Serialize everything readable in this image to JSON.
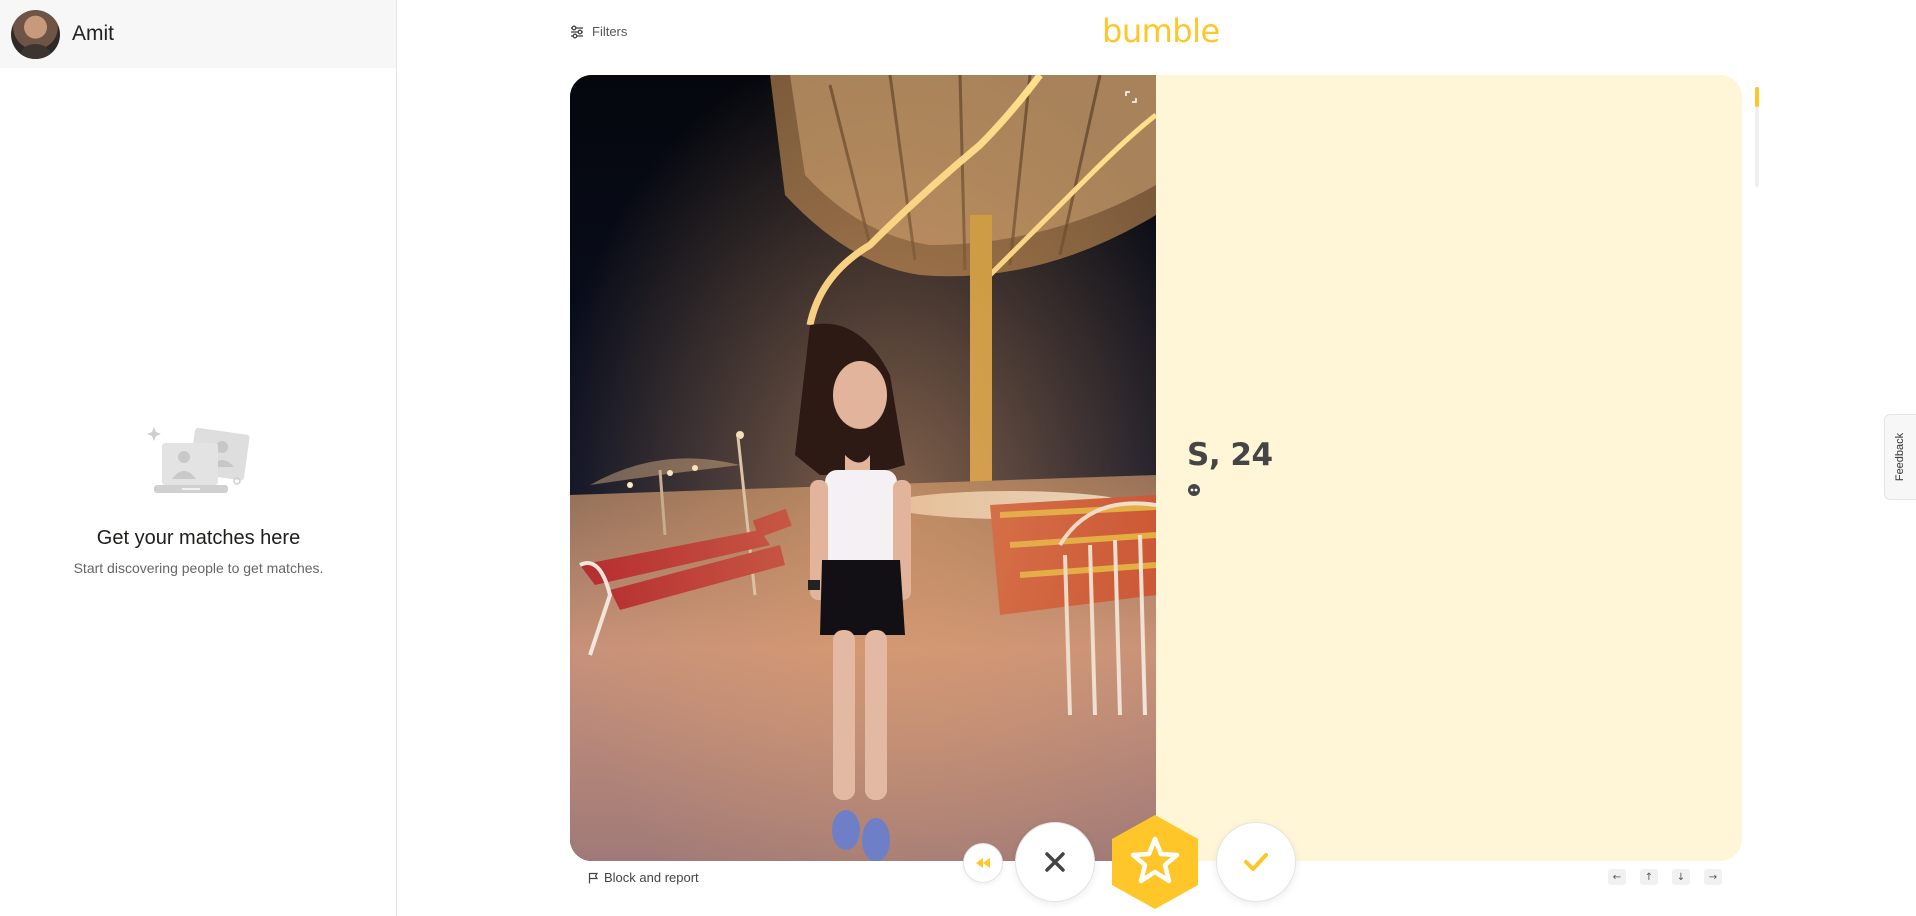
{
  "sidebar": {
    "user_name": "Amit",
    "empty_title": "Get your matches here",
    "empty_subtitle": "Start discovering people to get matches."
  },
  "header": {
    "filters_label": "Filters",
    "logo_text": "bumble"
  },
  "profile": {
    "name_age": "S, 24"
  },
  "footer": {
    "block_report_label": "Block and report",
    "keyboard_hints": [
      "←",
      "↑",
      "↓",
      "→"
    ]
  },
  "feedback_label": "Feedback",
  "colors": {
    "brand": "#ffc629",
    "card_bg": "#fff6d7"
  },
  "icons": {
    "filters": "sliders-icon",
    "rewind": "rewind-icon",
    "pass": "close-icon",
    "superswipe": "star-icon",
    "like": "check-icon",
    "block": "flag-icon",
    "expand": "expand-icon",
    "badge": "quote-icon"
  }
}
